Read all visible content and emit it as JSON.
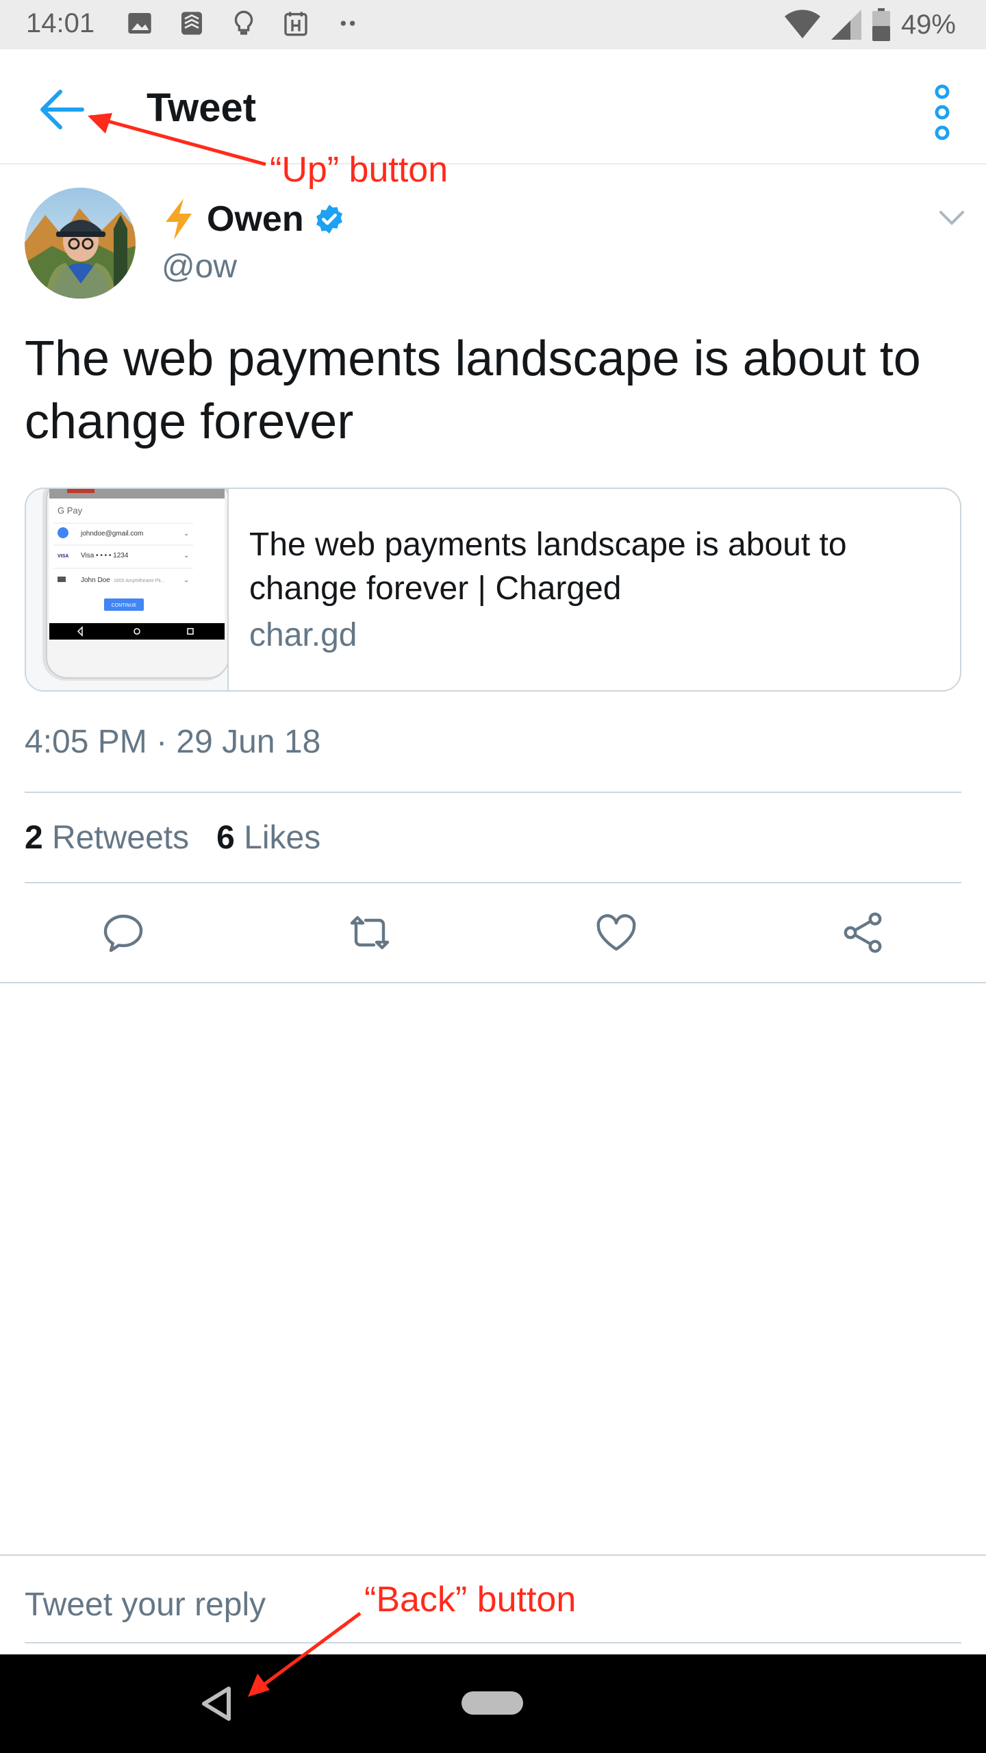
{
  "status_bar": {
    "time": "14:01",
    "battery": "49%",
    "icons": [
      "image-icon",
      "layers-icon",
      "lightbulb-icon",
      "calendar-icon",
      "more-notifications-icon",
      "wifi-icon",
      "signal-icon",
      "battery-icon"
    ]
  },
  "toolbar": {
    "title": "Tweet",
    "up_icon": "arrow-left-icon",
    "overflow_icon": "more-vertical-icon"
  },
  "tweet": {
    "display_name": "Owen",
    "handle": "@ow",
    "text": "The web payments landscape is about to change forever",
    "timestamp": "4:05 PM · 29 Jun 18",
    "retweets_count": "2",
    "retweets_label": "Retweets",
    "likes_count": "6",
    "likes_label": "Likes"
  },
  "card": {
    "title": "The web payments landscape is about to change forever | Charged",
    "domain": "char.gd",
    "thumb": {
      "brand": "G Pay",
      "email": "johndoe@gmail.com",
      "card": "Visa • • • • 1234",
      "card_brand": "VISA",
      "name": "John Doe",
      "address": "1600 Amphitheatre Pk...",
      "button": "CONTINUE"
    }
  },
  "actions": [
    "reply-icon",
    "retweet-icon",
    "like-icon",
    "share-icon"
  ],
  "reply": {
    "placeholder": "Tweet your reply"
  },
  "annotations": {
    "up": "“Up” button",
    "back": "“Back” button"
  },
  "colors": {
    "accent": "#1da1f2",
    "text": "#14171a",
    "secondary": "#657786",
    "annotation": "#ff2a1a"
  }
}
